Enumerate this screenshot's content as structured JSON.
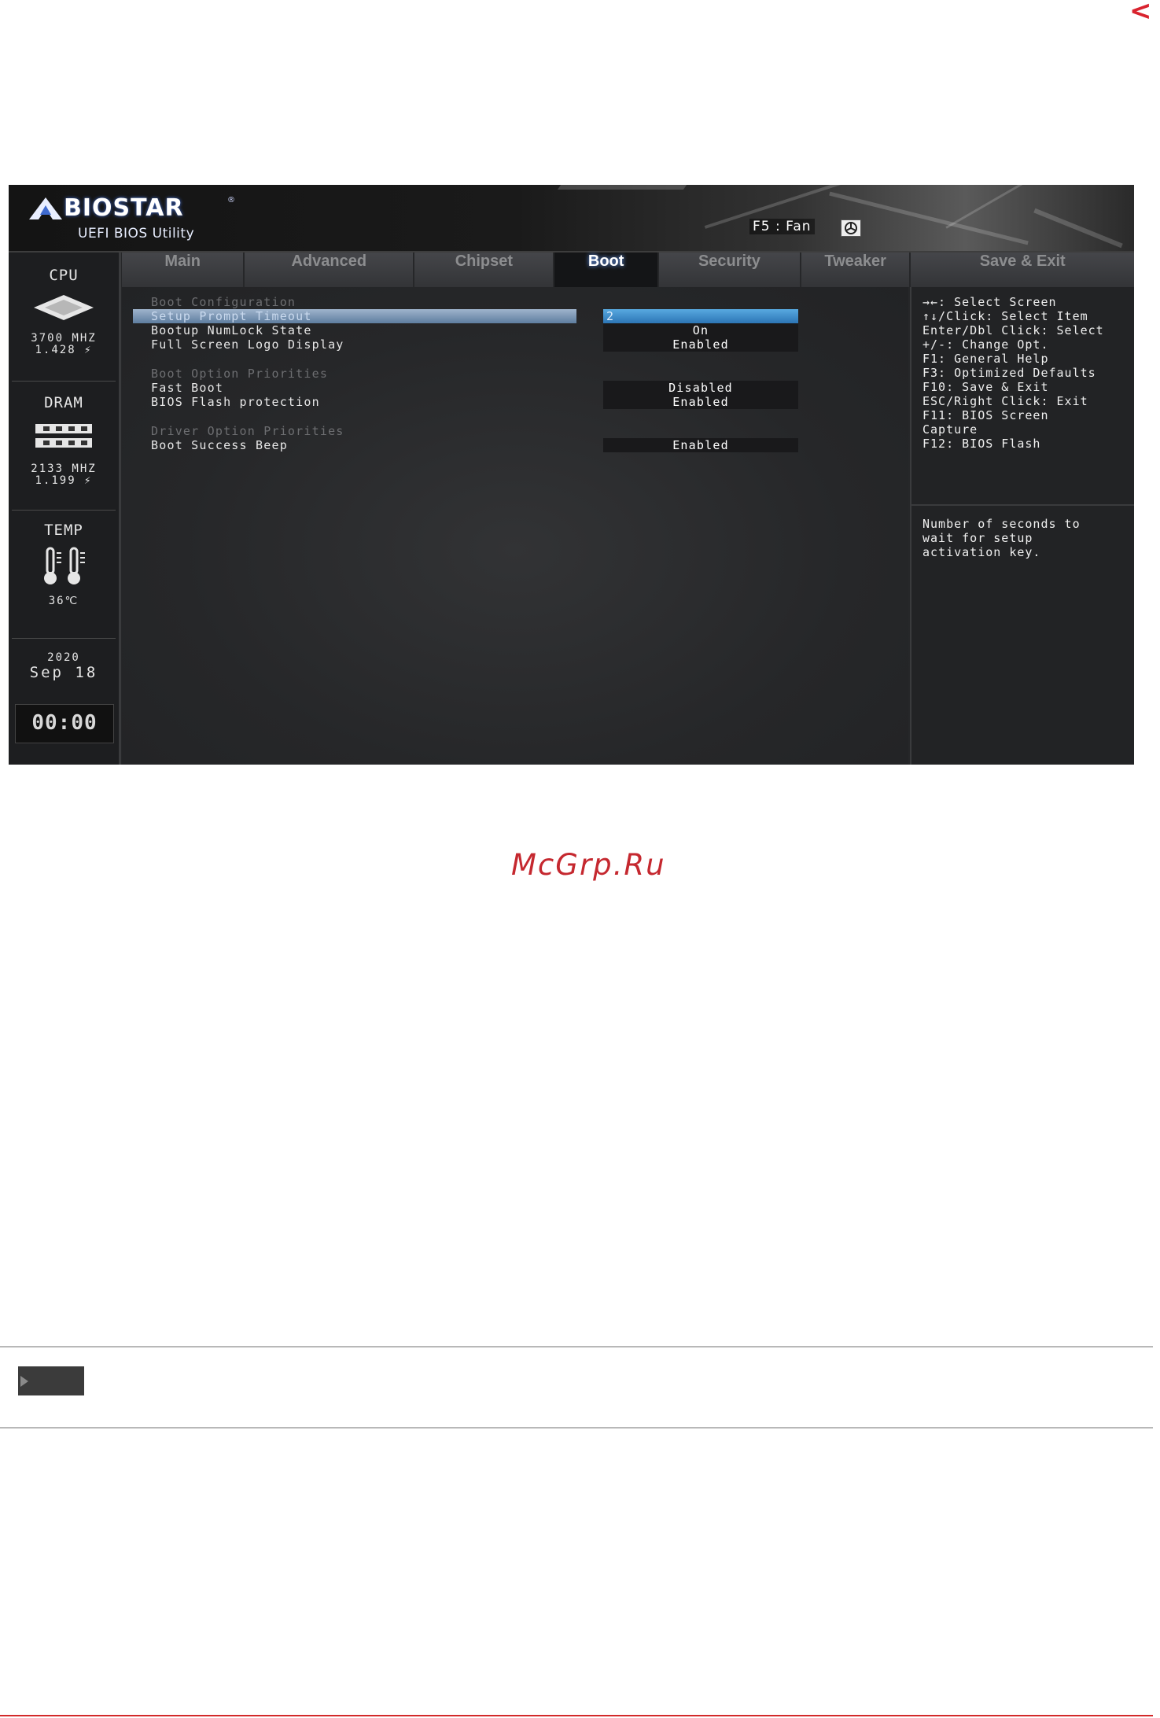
{
  "page": {
    "nav_arrow": "<",
    "watermark": "McGrp.Ru"
  },
  "header": {
    "brand": "BIOSTAR",
    "reg_mark": "®",
    "subtitle": "UEFI BIOS Utility",
    "fan_hint": "F5 : Fan"
  },
  "status": {
    "cpu": {
      "title": "CPU",
      "freq": "3700 MHZ",
      "volt": "1.428 ⚡"
    },
    "dram": {
      "title": "DRAM",
      "freq": "2133 MHZ",
      "volt": "1.199 ⚡"
    },
    "temp": {
      "title": "TEMP",
      "value": "36℃"
    },
    "date": {
      "year": "2020",
      "day": "Sep 18"
    },
    "clock": "00:00"
  },
  "tabs": [
    {
      "label": "Main"
    },
    {
      "label": "Advanced"
    },
    {
      "label": "Chipset"
    },
    {
      "label": "Boot"
    },
    {
      "label": "Security"
    },
    {
      "label": "Tweaker"
    },
    {
      "label": "Save & Exit"
    }
  ],
  "active_tab": "Boot",
  "items": [
    {
      "label": "Boot Configuration",
      "kind": "section"
    },
    {
      "label": "Setup Prompt Timeout",
      "value": "2",
      "kind": "option",
      "selected": true
    },
    {
      "label": "Bootup NumLock State",
      "value": "On",
      "kind": "option"
    },
    {
      "label": "Full Screen Logo Display",
      "value": "Enabled",
      "kind": "option"
    },
    {
      "label": "Boot Option Priorities",
      "kind": "section"
    },
    {
      "label": "Fast Boot",
      "value": "Disabled",
      "kind": "option"
    },
    {
      "label": "BIOS Flash protection",
      "value": "Enabled",
      "kind": "option"
    },
    {
      "label": "Driver Option Priorities",
      "kind": "section"
    },
    {
      "label": "Boot Success Beep",
      "value": "Enabled",
      "kind": "option"
    }
  ],
  "help": {
    "keys": [
      "→←: Select Screen",
      "↑↓/Click: Select Item",
      "Enter/Dbl Click: Select",
      "+/-: Change Opt.",
      "F1: General Help",
      "F3: Optimized Defaults",
      "F10: Save & Exit",
      "ESC/Right Click: Exit",
      "F11: BIOS Screen",
      "Capture",
      "F12: BIOS Flash"
    ],
    "description": [
      "Number of seconds to",
      "wait for setup",
      "activation key."
    ]
  },
  "colors": {
    "accent_red": "#d9232e",
    "selection_blue": "#2c75b5",
    "bios_bg": "#262729"
  }
}
